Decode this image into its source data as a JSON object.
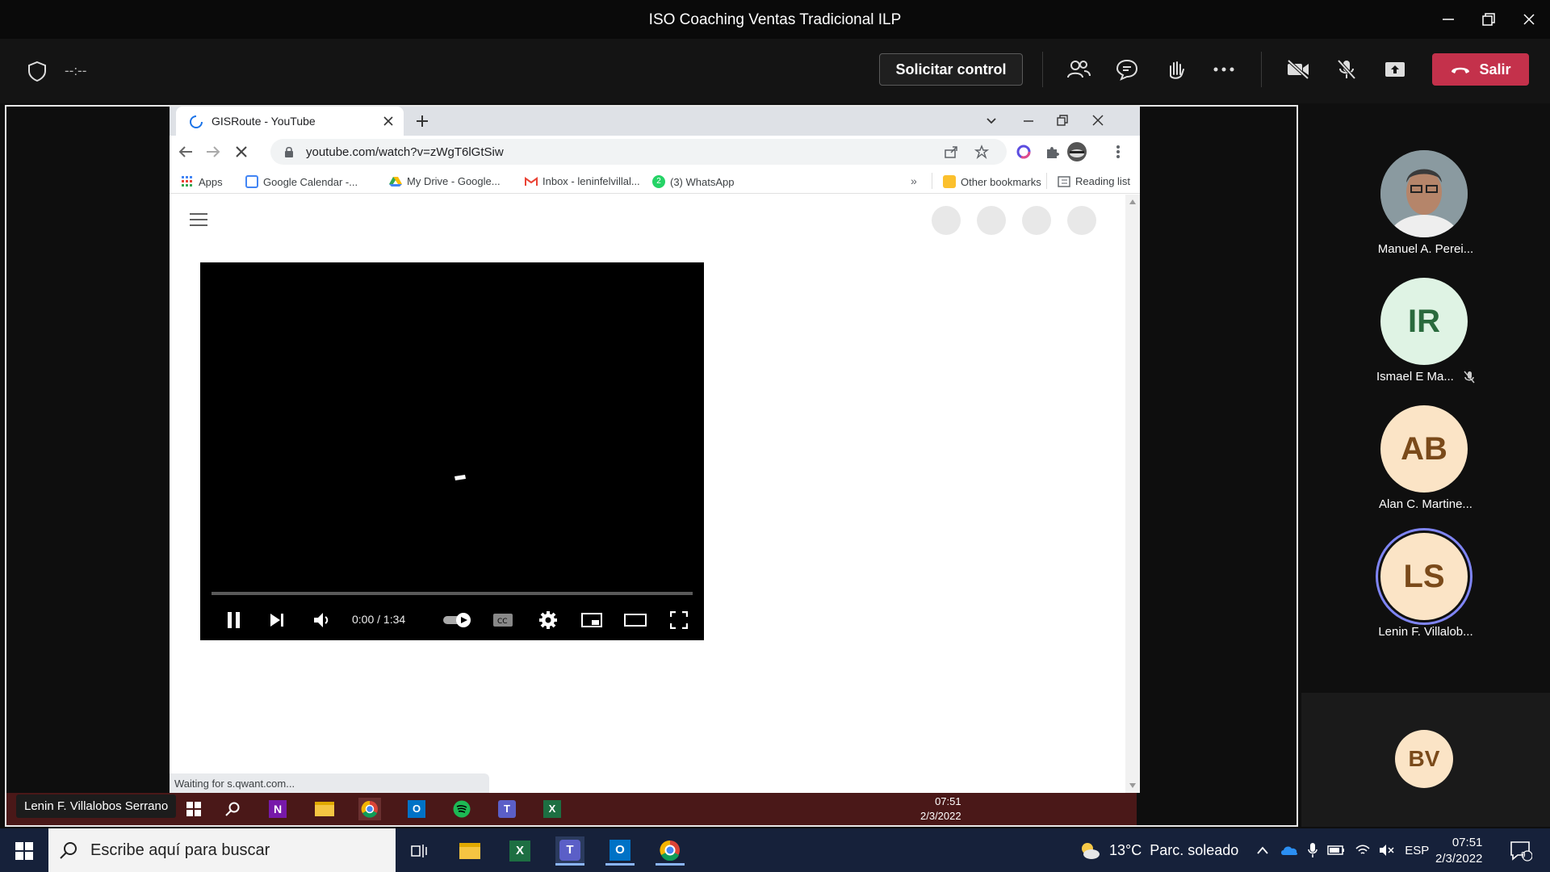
{
  "teams": {
    "window_title": "ISO Coaching Ventas Tradicional ILP",
    "timer": "--:--",
    "request_control_label": "Solicitar control",
    "leave_label": "Salir",
    "leave_color": "#c4314b"
  },
  "chrome": {
    "tab_title": "GISRoute - YouTube",
    "url": "youtube.com/watch?v=zWgT6lGtSiw",
    "bookmarks": [
      {
        "label": "Apps",
        "icon": "apps-grid-icon"
      },
      {
        "label": "Google Calendar -...",
        "icon": "calendar-icon"
      },
      {
        "label": "My Drive - Google...",
        "icon": "drive-icon"
      },
      {
        "label": "Inbox - leninfelvillal...",
        "icon": "gmail-icon"
      },
      {
        "label": "(3) WhatsApp",
        "icon": "whatsapp-icon"
      }
    ],
    "other_bookmarks": "Other bookmarks",
    "reading_list": "Reading list",
    "status_text": "Waiting for s.qwant.com..."
  },
  "player": {
    "time": "0:00 / 1:34",
    "progress": 0
  },
  "remote_taskbar": {
    "time": "07:51",
    "date": "2/3/2022",
    "presenter": "Lenin F. Villalobos Serrano"
  },
  "participants": [
    {
      "name": "Manuel A. Perei...",
      "initials": "",
      "photo": true
    },
    {
      "name": "Ismael E Ma...",
      "initials": "IR",
      "muted": true
    },
    {
      "name": "Alan C. Martine...",
      "initials": "AB"
    },
    {
      "name": "Lenin F. Villalob...",
      "initials": "LS",
      "speaking": true
    }
  ],
  "overflow_participant": {
    "initials": "BV"
  },
  "host_taskbar": {
    "search_placeholder": "Escribe aquí para buscar",
    "weather": "13°C  Parc. soleado",
    "language": "ESP",
    "time": "07:51",
    "date": "2/3/2022",
    "notifications": "9"
  }
}
